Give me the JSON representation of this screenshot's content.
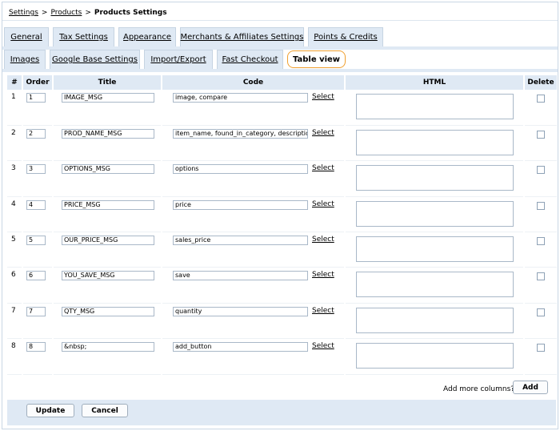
{
  "breadcrumb": {
    "link1": "Settings",
    "link2": "Products",
    "current": "Products Settings",
    "sep": ">"
  },
  "tabs_row1": [
    "General",
    "Tax Settings",
    "Appearance",
    "Merchants & Affiliates Settings",
    "Points & Credits"
  ],
  "tabs_row2": [
    "Images",
    "Google Base Settings",
    "Import/Export",
    "Fast Checkout",
    "Table view"
  ],
  "table": {
    "headers": {
      "num": "#",
      "order": "Order",
      "title": "Title",
      "code": "Code",
      "html": "HTML",
      "delete": "Delete"
    },
    "select_label": "Select",
    "rows": [
      {
        "num": "1",
        "order": "1",
        "title": "IMAGE_MSG",
        "code": "image, compare"
      },
      {
        "num": "2",
        "order": "2",
        "title": "PROD_NAME_MSG",
        "code": "item_name, found_in_category, description"
      },
      {
        "num": "3",
        "order": "3",
        "title": "OPTIONS_MSG",
        "code": "options"
      },
      {
        "num": "4",
        "order": "4",
        "title": "PRICE_MSG",
        "code": "price"
      },
      {
        "num": "5",
        "order": "5",
        "title": "OUR_PRICE_MSG",
        "code": "sales_price"
      },
      {
        "num": "6",
        "order": "6",
        "title": "YOU_SAVE_MSG",
        "code": "save"
      },
      {
        "num": "7",
        "order": "7",
        "title": "QTY_MSG",
        "code": "quantity"
      },
      {
        "num": "8",
        "order": "8",
        "title": "&nbsp;",
        "code": "add_button"
      }
    ]
  },
  "add_more": {
    "label": "Add more columns?",
    "button": "Add"
  },
  "footer": {
    "update": "Update",
    "cancel": "Cancel"
  }
}
